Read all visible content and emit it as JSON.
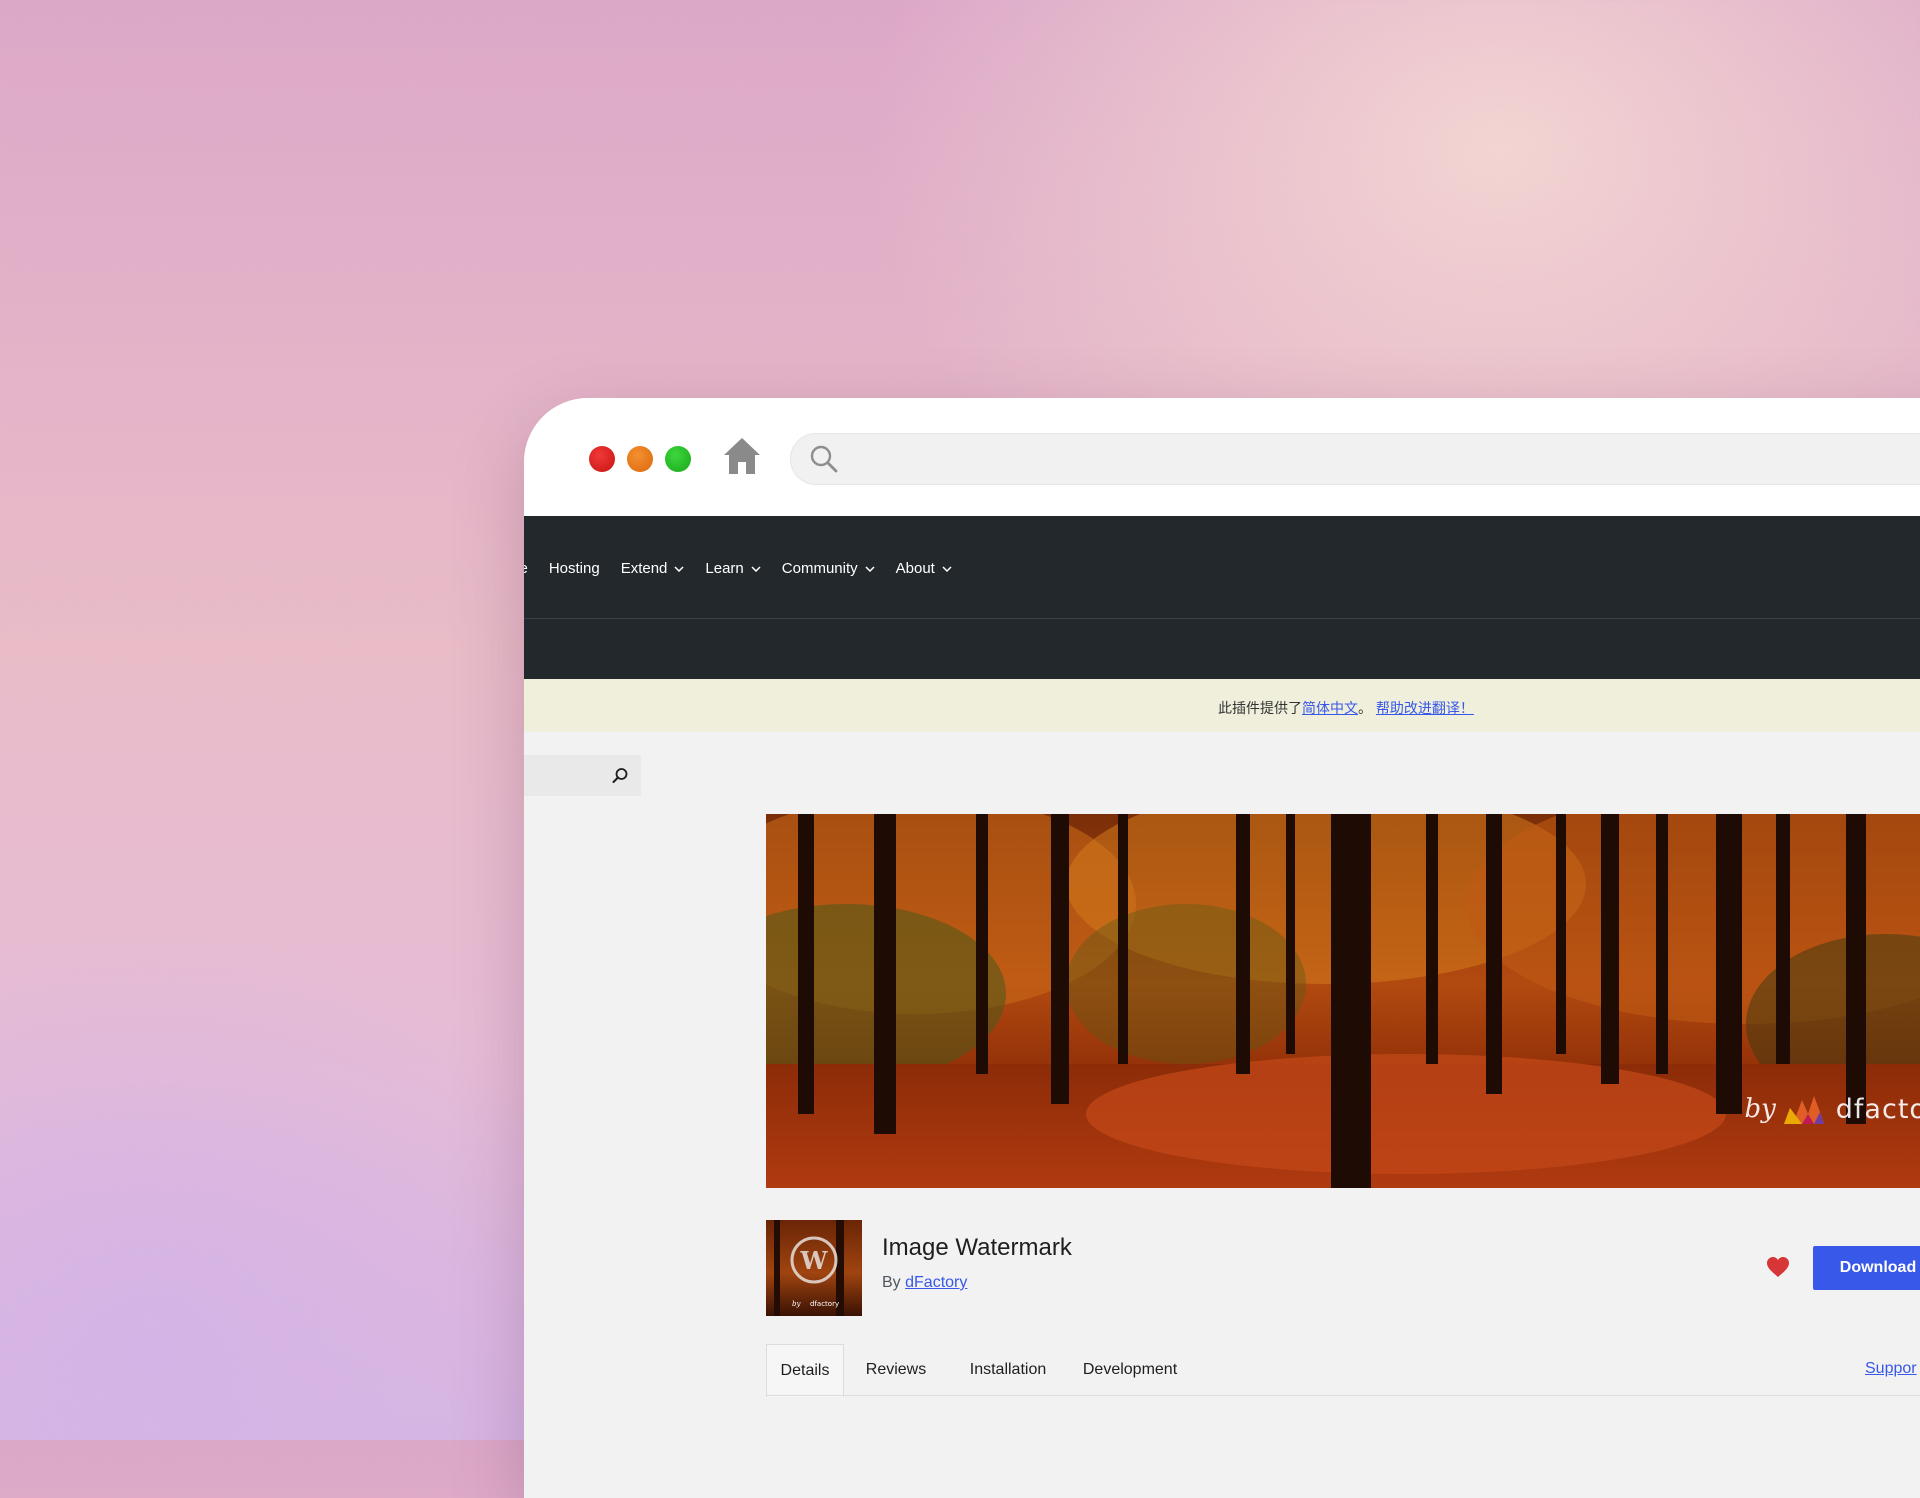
{
  "nav": {
    "items": [
      {
        "label": "se",
        "has_dropdown": false
      },
      {
        "label": "Hosting",
        "has_dropdown": false
      },
      {
        "label": "Extend",
        "has_dropdown": true
      },
      {
        "label": "Learn",
        "has_dropdown": true
      },
      {
        "label": "Community",
        "has_dropdown": true
      },
      {
        "label": "About",
        "has_dropdown": true
      }
    ]
  },
  "notice": {
    "prefix": "此插件提供了",
    "language_link": "简体中文",
    "separator": "。",
    "help_link": "帮助改进翻译！"
  },
  "banner": {
    "by": "by",
    "brand": "dfactory"
  },
  "plugin": {
    "title": "Image Watermark",
    "author_prefix": "By",
    "author": "dFactory",
    "download_label": "Download",
    "icon_by": "by",
    "icon_brand": "dfactory"
  },
  "tabs": [
    {
      "label": "Details",
      "active": true
    },
    {
      "label": "Reviews",
      "active": false
    },
    {
      "label": "Installation",
      "active": false
    },
    {
      "label": "Development",
      "active": false
    }
  ],
  "support_label": "Suppor",
  "colors": {
    "nav_bg": "#23282d",
    "notice_bg": "#efefdc",
    "accent": "#3858e9",
    "heart": "#d63638"
  }
}
